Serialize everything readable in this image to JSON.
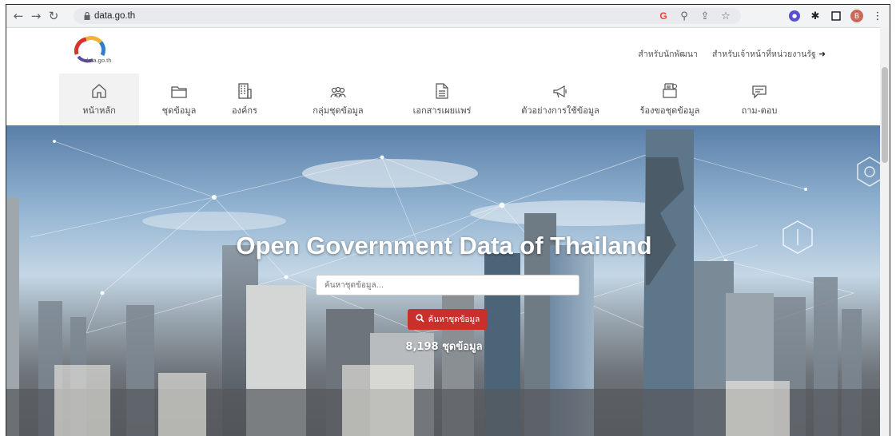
{
  "browser": {
    "url": "data.go.th",
    "profile_initial": "B"
  },
  "site": {
    "logo_text": "data.go.th",
    "top_links": {
      "developer": "สำหรับนักพัฒนา",
      "officer": "สำหรับเจ้าหน้าที่หน่วยงานรัฐ"
    }
  },
  "nav": {
    "items": [
      {
        "label": "หน้าหลัก",
        "icon": "home-icon"
      },
      {
        "label": "ชุดข้อมูล",
        "icon": "folder-icon"
      },
      {
        "label": "องค์กร",
        "icon": "building-icon"
      },
      {
        "label": "กลุ่มชุดข้อมูล",
        "icon": "group-icon"
      },
      {
        "label": "เอกสารเผยแพร่",
        "icon": "document-icon"
      },
      {
        "label": "ตัวอย่างการใช้ข้อมูล",
        "icon": "megaphone-icon"
      },
      {
        "label": "ร้องขอชุดข้อมูล",
        "icon": "request-icon"
      },
      {
        "label": "ถาม-ตอบ",
        "icon": "chat-icon"
      }
    ]
  },
  "hero": {
    "title": "Open Government Data of Thailand",
    "search_placeholder": "ค้นหาชุดข้อมูล...",
    "search_button": "ค้นหาชุดข้อมูล",
    "dataset_count": "8,198 ชุดข้อมูล"
  },
  "colors": {
    "primary_red": "#c9302c",
    "nav_text": "#4a4a4a"
  }
}
